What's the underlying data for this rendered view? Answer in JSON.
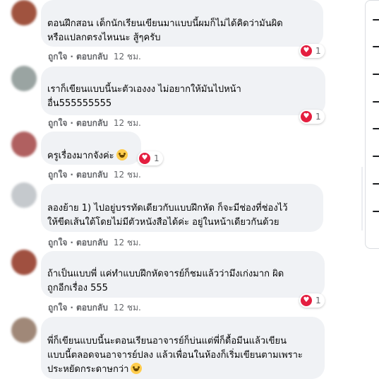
{
  "actions": {
    "like": "ถูกใจ",
    "dot": "·",
    "reply": "ตอบกลับ"
  },
  "comments": [
    {
      "lines": [
        "ตอนฝึกสอน เด็กนักเรียนเขียนมาแบบนี้ผมก็ไม่ได้คิดว่ามันผิด",
        "หรือแปลกตรงไหนนะ สู้ๆครับ"
      ],
      "time": "12 ชม.",
      "reaction_count": "1"
    },
    {
      "lines": [
        "เราก็เขียนแบบนี้นะตัวเองงง ไม่อยากให้มันไปหน้า",
        "อื่น555555555"
      ],
      "time": "12 ชม.",
      "reaction_count": "1"
    },
    {
      "lines": [
        "ครูเรื่องมากจังค่ะ"
      ],
      "time": "12 ชม.",
      "reaction_count": "1",
      "emoji": "grinning-face"
    },
    {
      "lines": [
        "ลองย้าย 1) ไปอยู่บรรทัดเดียวกับแบบฝึกหัด ก็จะมีช่องที่ช่องไว้",
        "ให้ขีดเส้นใต้โดยไม่มีตัวหนังสือได้ค่ะ อยู่ในหน้าเดียวกันด้วย"
      ],
      "time": "12 ชม.",
      "reaction_count": ""
    },
    {
      "lines": [
        "ถ้าเป็นแบบพี่ แค่ทำแบบฝึกหัดจารย์ก็ชมแล้วว่ามึงเก่งมาก ผิด",
        "ถูกอีกเรื่อง 555"
      ],
      "time": "12 ชม.",
      "reaction_count": "1"
    },
    {
      "lines": [
        "พี่ก็เขียนแบบนี้นะตอนเรียนอาจารย์ก็บ่นแต่พี่ก็ดื้อมีนแล้วเขียน",
        "แบบนี้ตลอดจนอาจารย์ปลง แล้วเพื่อนในห้องก็เริ่มเขียนตามเพราะ",
        "ประหยัดกระดาษกว่า"
      ],
      "emoji": "laughing-face"
    }
  ],
  "colors": {
    "bubble": "#f0f2f5",
    "heart": "#e41e3f",
    "meta_text": "#65676b",
    "emoji": "#ffcc4d"
  },
  "icons": [
    "heart-reaction-icon",
    "grinning-face-emoji-icon",
    "laughing-face-emoji-icon",
    "menu-lines-icon"
  ]
}
